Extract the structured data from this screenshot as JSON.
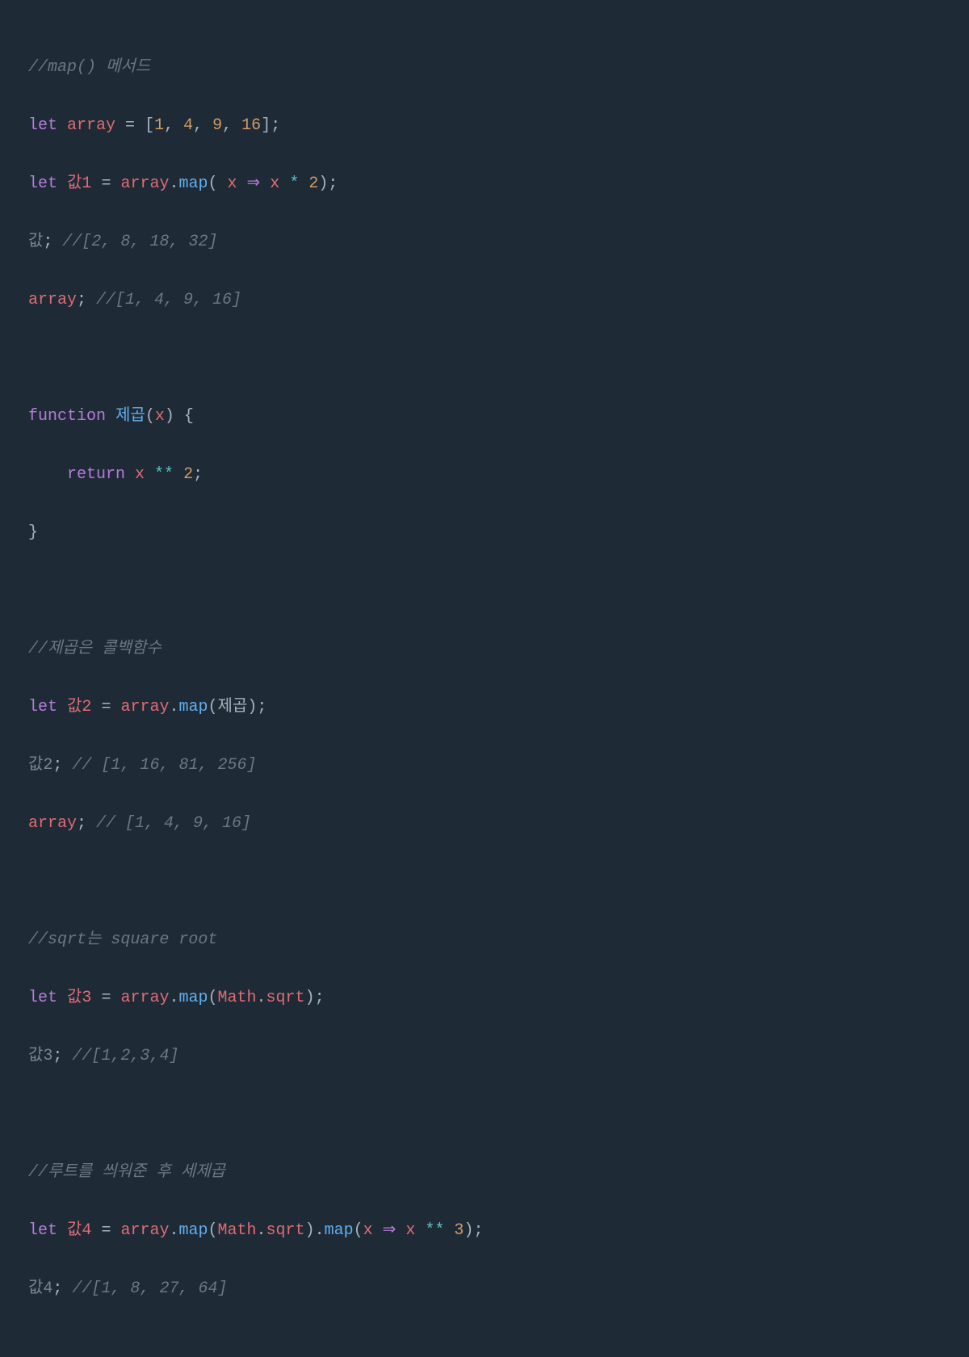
{
  "code": {
    "line1": {
      "comment": "//map() 메서드"
    },
    "line2": {
      "keyword": "let",
      "ident": "array",
      "eq": " = ",
      "bracket_open": "[",
      "n1": "1",
      "c1": ", ",
      "n2": "4",
      "c2": ", ",
      "n3": "9",
      "c3": ", ",
      "n4": "16",
      "bracket_close": "];"
    },
    "line3": {
      "keyword": "let",
      "ident": "값1",
      "eq": " = ",
      "arr": "array",
      "dot": ".",
      "method": "map",
      "paren": "( ",
      "param": "x",
      "arrow": " ⇒ ",
      "param2": "x",
      "op": " * ",
      "num": "2",
      "close": ");"
    },
    "line4": {
      "var": "값",
      "semi": "; ",
      "comment": "//[2, 8, 18, 32]"
    },
    "line5": {
      "var": "array",
      "semi": "; ",
      "comment": "//[1, 4, 9, 16]"
    },
    "line7": {
      "keyword": "function",
      "name": " 제곱",
      "paren_open": "(",
      "param": "x",
      "paren_close": ") {"
    },
    "line8": {
      "indent": "    ",
      "keyword": "return",
      "param": " x ",
      "op": "**",
      "num": " 2",
      "semi": ";"
    },
    "line9": {
      "brace": "}"
    },
    "line11": {
      "comment": "//제곱은 콜백함수"
    },
    "line12": {
      "keyword": "let",
      "ident": "값2",
      "eq": " = ",
      "arr": "array",
      "dot": ".",
      "method": "map",
      "paren": "(",
      "callback": "제곱",
      "close": ");"
    },
    "line13": {
      "var": "값2",
      "semi": "; ",
      "comment": "// [1, 16, 81, 256]"
    },
    "line14": {
      "var": "array",
      "semi": "; ",
      "comment": "// [1, 4, 9, 16]"
    },
    "line16": {
      "comment": "//sqrt는 square root"
    },
    "line17": {
      "keyword": "let",
      "ident": "값3",
      "eq": " = ",
      "arr": "array",
      "dot": ".",
      "method": "map",
      "paren": "(",
      "obj": "Math",
      "dot2": ".",
      "prop": "sqrt",
      "close": ");"
    },
    "line18": {
      "var": "값3",
      "semi": "; ",
      "comment": "//[1,2,3,4]"
    },
    "line20": {
      "comment": "//루트를 씌워준 후 세제곱"
    },
    "line21": {
      "keyword": "let",
      "ident": "값4",
      "eq": " = ",
      "arr": "array",
      "dot": ".",
      "method": "map",
      "paren": "(",
      "obj": "Math",
      "dot2": ".",
      "prop": "sqrt",
      "close1": ").",
      "method2": "map",
      "paren2": "(",
      "param": "x",
      "arrow": " ⇒ ",
      "param2": "x",
      "op": " ** ",
      "num": "3",
      "close2": ");"
    },
    "line22": {
      "var": "값4",
      "semi": "; ",
      "comment": "//[1, 8, 27, 64]"
    }
  }
}
